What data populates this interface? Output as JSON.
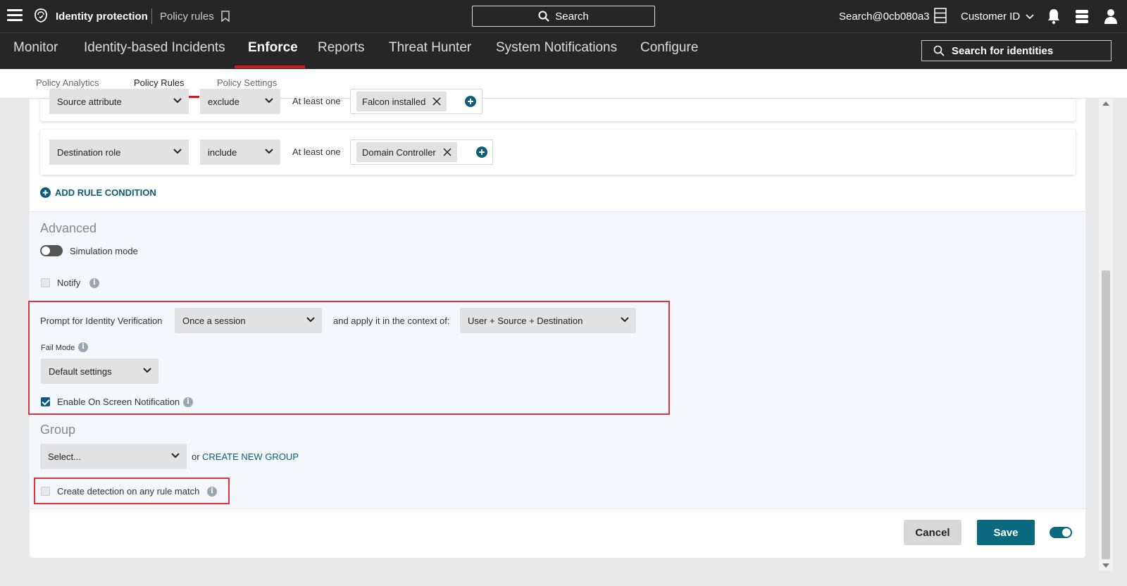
{
  "topbar": {
    "app_title": "Identity protection",
    "page": "Policy rules",
    "search_label": "Search",
    "user": "Search@0cb080a3",
    "customer": "Customer ID"
  },
  "nav": {
    "items": [
      "Monitor",
      "Identity-based Incidents",
      "Enforce",
      "Reports",
      "Threat Hunter",
      "System Notifications",
      "Configure"
    ],
    "active": "Enforce",
    "identity_search": "Search for identities"
  },
  "subtabs": {
    "items": [
      "Policy Analytics",
      "Policy Rules",
      "Policy Settings"
    ],
    "active": "Policy Rules"
  },
  "conditions": [
    {
      "field": "Source attribute",
      "op": "exclude",
      "match": "At least one",
      "tags": [
        "Falcon installed"
      ]
    },
    {
      "field": "Destination role",
      "op": "include",
      "match": "At least one",
      "tags": [
        "Domain Controller"
      ]
    }
  ],
  "add_condition_label": "ADD RULE CONDITION",
  "advanced": {
    "title": "Advanced",
    "simulation_label": "Simulation mode",
    "simulation_on": false,
    "notify_label": "Notify",
    "notify_checked": false,
    "prompt_label": "Prompt for Identity Verification",
    "prompt_value": "Once a session",
    "context_label": "and apply it in the context of:",
    "context_value": "User + Source + Destination",
    "fail_mode_label": "Fail Mode",
    "fail_mode_value": "Default settings",
    "notification_label": "Enable On Screen Notification",
    "notification_checked": true
  },
  "group": {
    "title": "Group",
    "select_placeholder": "Select...",
    "or_label": "or",
    "create_link": "CREATE NEW GROUP",
    "detection_label": "Create detection on any rule match",
    "detection_checked": false
  },
  "footer": {
    "cancel": "Cancel",
    "save": "Save",
    "enabled": true
  },
  "colors": {
    "topbar": "#262626",
    "accent_red": "#d71920",
    "teal": "#0b6a80",
    "highlight": "#e0333b"
  }
}
